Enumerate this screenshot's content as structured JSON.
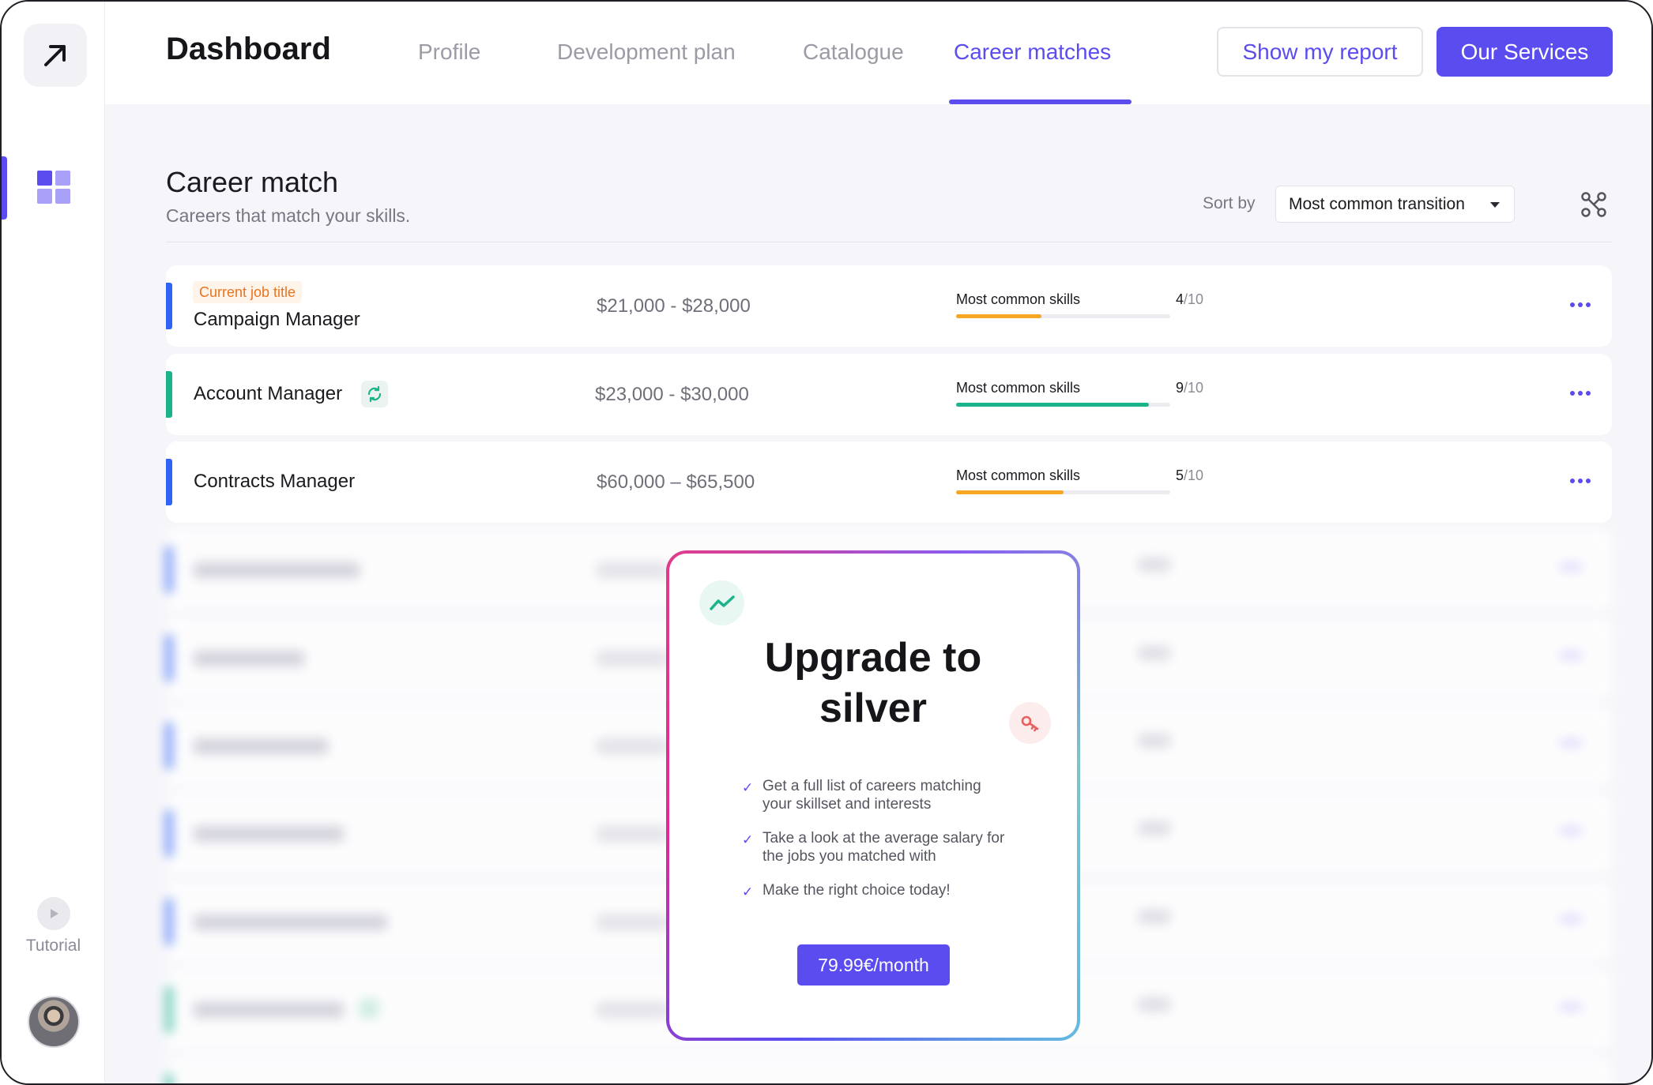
{
  "header": {
    "title": "Dashboard",
    "tabs": [
      {
        "label": "Profile"
      },
      {
        "label": "Development plan"
      },
      {
        "label": "Catalogue"
      },
      {
        "label": "Career matches",
        "active": true
      }
    ],
    "report_button": "Show my report",
    "services_button": "Our Services"
  },
  "sidebar": {
    "logo_icon": "arrow-up-right-icon",
    "nav_icon": "grid-icon",
    "tutorial_label": "Tutorial",
    "avatar": "user-avatar"
  },
  "main": {
    "title": "Career match",
    "subtitle": "Careers that match your skills.",
    "sort_label": "Sort by",
    "sort_value": "Most common transition",
    "rows": [
      {
        "tag": "Current job title",
        "job": "Campaign Manager",
        "salary": "$21,000 - $28,000",
        "skill_label": "Most common skills",
        "score": "4",
        "den": "/10",
        "fraction": 0.4,
        "color": "#f5a623",
        "bar": "#2f62f5"
      },
      {
        "job": "Account Manager",
        "salary": "$23,000 - $30,000",
        "skill_label": "Most common skills",
        "score": "9",
        "den": "/10",
        "fraction": 0.9,
        "color": "#1bb38a",
        "bar": "#1bb38a"
      },
      {
        "job": "Contracts Manager",
        "salary": "$60,000 – $65,500",
        "skill_label": "Most common skills",
        "score": "5",
        "den": "/10",
        "fraction": 0.5,
        "color": "#f5a623",
        "bar": "#2f62f5"
      }
    ]
  },
  "modal": {
    "headline_1": "Upgrade to",
    "headline_2": "silver",
    "features": [
      "Get a full list of careers matching your skillset and interests",
      "Take a look at the average salary for the jobs you matched with",
      "Make the right choice today!"
    ],
    "price": "79.99€/month"
  },
  "colors": {
    "accent": "#5b4cf0",
    "orange": "#f5a623",
    "green": "#1bb38a",
    "blue": "#2f62f5"
  }
}
